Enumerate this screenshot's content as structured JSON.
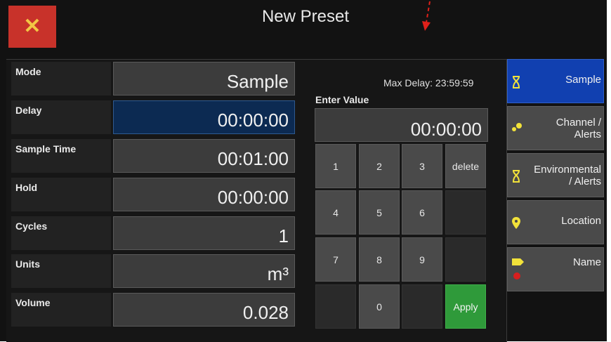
{
  "header": {
    "title": "New Preset",
    "close_label": "✕"
  },
  "fields": [
    {
      "label": "Mode",
      "value": "Sample"
    },
    {
      "label": "Delay",
      "value": "00:00:00",
      "active": true
    },
    {
      "label": "Sample Time",
      "value": "00:01:00"
    },
    {
      "label": "Hold",
      "value": "00:00:00"
    },
    {
      "label": "Cycles",
      "value": "1"
    },
    {
      "label": "Units",
      "value": "m³"
    },
    {
      "label": "Volume",
      "value": "0.028"
    }
  ],
  "keypad": {
    "max_delay": "Max Delay: 23:59:59",
    "enter_value_label": "Enter Value",
    "display_value": "00:00:00",
    "keys": [
      "1",
      "2",
      "3",
      "delete",
      "4",
      "5",
      "6",
      "",
      "7",
      "8",
      "9",
      "",
      "",
      "0",
      "",
      "Apply"
    ]
  },
  "nav": [
    {
      "label": "Sample",
      "icon": "hourglass-icon",
      "active": true
    },
    {
      "label": "Channel /\nAlerts",
      "icon": "dots-icon"
    },
    {
      "label": "Environmental\n/ Alerts",
      "icon": "hourglass-icon"
    },
    {
      "label": "Location",
      "icon": "location-pin-icon"
    },
    {
      "label": "Name",
      "icon": "tag-icon"
    }
  ],
  "colors": {
    "close_bg": "#c8322a",
    "active_field": "#0c2a52",
    "active_nav": "#1140b0",
    "apply": "#2f9a3a",
    "icon_yellow": "#f2e23a"
  }
}
